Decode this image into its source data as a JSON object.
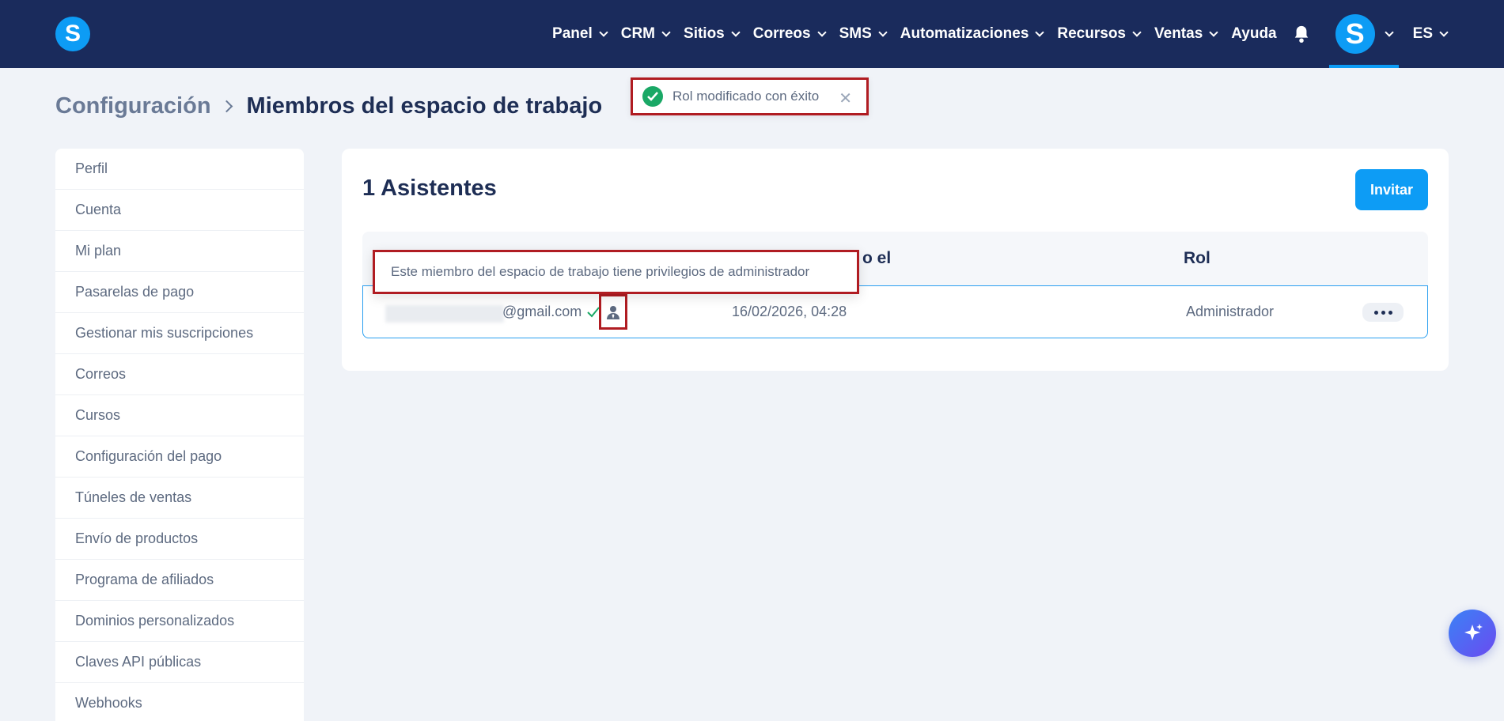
{
  "header": {
    "logo_letter": "S",
    "nav": [
      {
        "label": "Panel",
        "has_dropdown": true
      },
      {
        "label": "CRM",
        "has_dropdown": true
      },
      {
        "label": "Sitios",
        "has_dropdown": true
      },
      {
        "label": "Correos",
        "has_dropdown": true
      },
      {
        "label": "SMS",
        "has_dropdown": true
      },
      {
        "label": "Automatizaciones",
        "has_dropdown": true
      },
      {
        "label": "Recursos",
        "has_dropdown": true
      },
      {
        "label": "Ventas",
        "has_dropdown": true
      },
      {
        "label": "Ayuda",
        "has_dropdown": false
      }
    ],
    "bell_icon": "bell-icon",
    "avatar_letter": "S",
    "language": "ES"
  },
  "breadcrumb": {
    "parent": "Configuración",
    "current": "Miembros del espacio de trabajo"
  },
  "toast": {
    "message": "Rol modificado con éxito",
    "close": "✕"
  },
  "sidebar": {
    "items": [
      "Perfil",
      "Cuenta",
      "Mi plan",
      "Pasarelas de pago",
      "Gestionar mis suscripciones",
      "Correos",
      "Cursos",
      "Configuración del pago",
      "Túneles de ventas",
      "Envío de productos",
      "Programa de afiliados",
      "Dominios personalizados",
      "Claves API públicas",
      "Webhooks"
    ]
  },
  "members": {
    "title": "1 Asistentes",
    "invite_label": "Invitar",
    "columns": {
      "date_partial": "o el",
      "role": "Rol"
    },
    "rows": [
      {
        "email": "@gmail.com",
        "date": "16/02/2026, 04:28",
        "role": "Administrador"
      }
    ],
    "tooltip": "Este miembro del espacio de trabajo tiene privilegios de administrador"
  },
  "colors": {
    "header_bg": "#1a2b5c",
    "accent": "#0d9cf5",
    "highlight_border": "#b01c22",
    "success": "#1aa866"
  }
}
